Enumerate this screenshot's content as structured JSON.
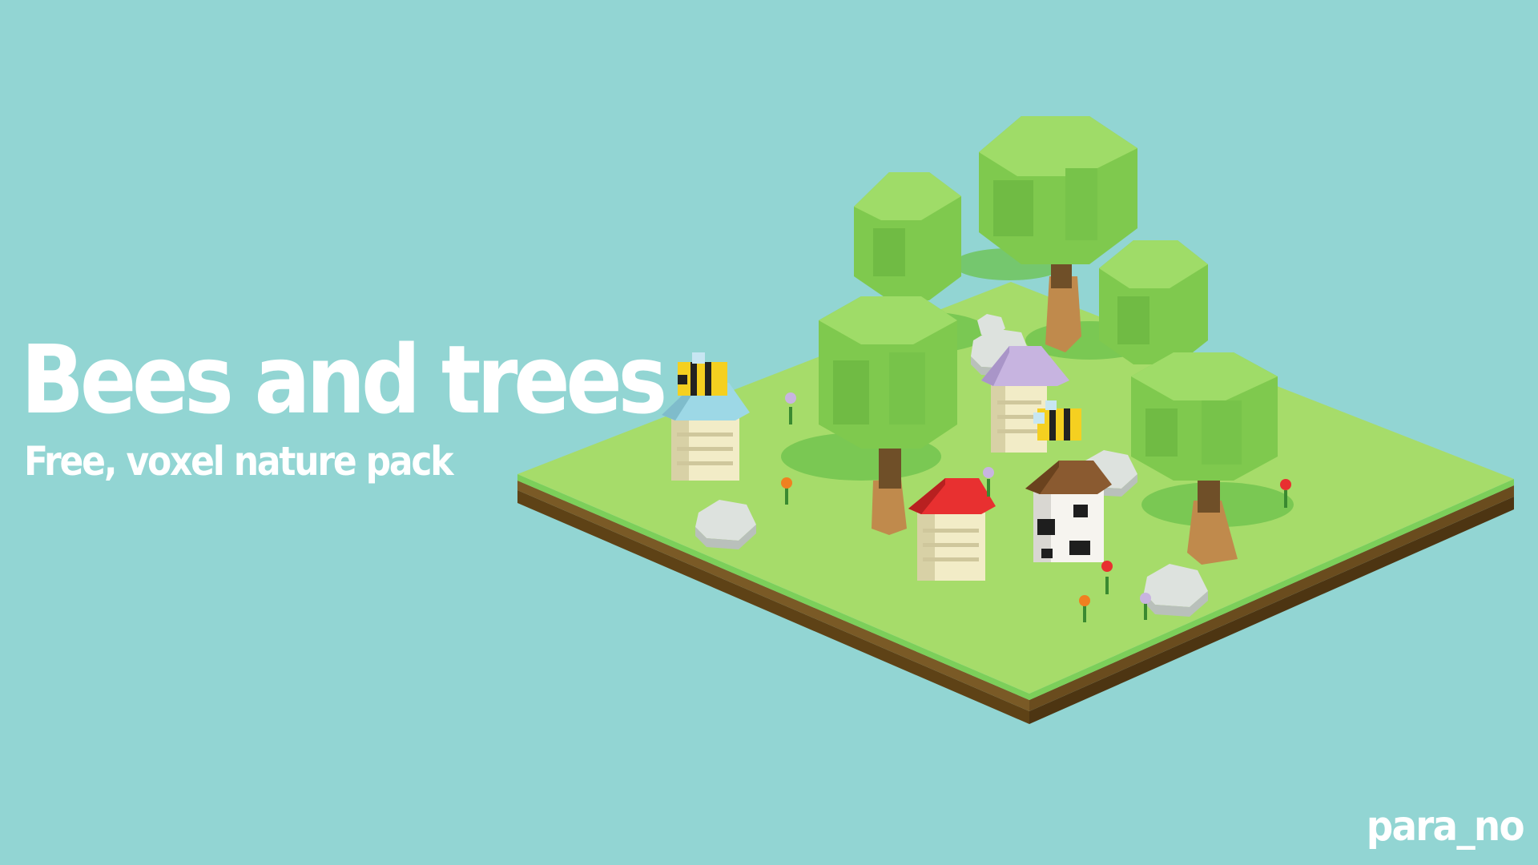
{
  "header": {
    "title": "Bees and trees",
    "subtitle": "Free, voxel nature pack"
  },
  "footer": {
    "signature": "para_no"
  },
  "scene": {
    "colors": {
      "background": "#92d5d3",
      "grass": "#a8de6c",
      "grass_edge": "#86c85a",
      "soil": "#6e4e22",
      "tree_leaves": "#8bd45a",
      "trunk": "#8b6a3c",
      "hive_body": "#f2ecc7",
      "roof_blue": "#9dd8e6",
      "roof_purple": "#c7b4e0",
      "roof_red": "#e83030",
      "roof_brown": "#8a5a30",
      "bee_yellow": "#f5d020"
    },
    "objects": [
      "tree",
      "tree",
      "tree",
      "tree",
      "tree",
      "hive",
      "hive",
      "hive",
      "hive",
      "bee",
      "bee",
      "rock",
      "rock",
      "rock",
      "rock",
      "rock",
      "flower",
      "flower",
      "flower",
      "flower",
      "flower",
      "flower",
      "flower"
    ]
  }
}
